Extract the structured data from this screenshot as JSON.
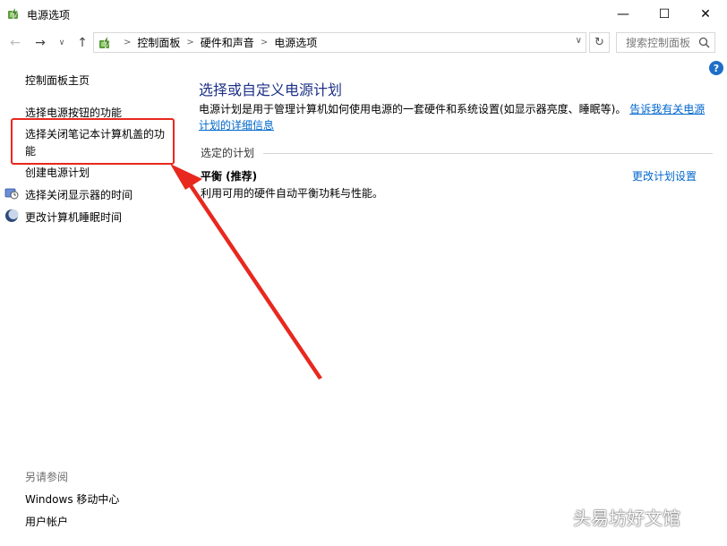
{
  "window": {
    "title": "电源选项",
    "minimize_glyph": "—",
    "maximize_glyph": "☐",
    "close_glyph": "✕"
  },
  "nav": {
    "back_glyph": "←",
    "forward_glyph": "→",
    "recent_glyph": "∨",
    "up_glyph": "↑",
    "breadcrumbs": [
      "控制面板",
      "硬件和声音",
      "电源选项"
    ],
    "refresh_glyph": "↻",
    "search_placeholder": "搜索控制面板"
  },
  "help": {
    "glyph": "?"
  },
  "sidebar": {
    "home": "控制面板主页",
    "items": [
      {
        "label": "选择电源按钮的功能",
        "icon": ""
      },
      {
        "label": "选择关闭笔记本计算机盖的功能",
        "icon": ""
      },
      {
        "label": "创建电源计划",
        "icon": ""
      },
      {
        "label": "选择关闭显示器的时间",
        "icon": "monitor-clock-icon"
      },
      {
        "label": "更改计算机睡眠时间",
        "icon": "moon-icon"
      }
    ],
    "see_also_title": "另请参阅",
    "see_also_links": [
      "Windows 移动中心",
      "用户帐户"
    ]
  },
  "main": {
    "title": "选择或自定义电源计划",
    "intro_text": "电源计划是用于管理计算机如何使用电源的一套硬件和系统设置(如显示器亮度、睡眠等)。",
    "intro_link": "告诉我有关电源计划的详细信息",
    "selected_plan_label": "选定的计划",
    "plan": {
      "name": "平衡 (推荐)",
      "description": "利用可用的硬件自动平衡功耗与性能。",
      "change_link": "更改计划设置"
    }
  },
  "annotation": {
    "highlight_color": "#e8281e"
  },
  "watermark": {
    "text": "头易坊好文馆"
  },
  "colors": {
    "title_blue": "#1e3287",
    "link_blue": "#0066cc",
    "help_blue": "#1e6ec8"
  }
}
